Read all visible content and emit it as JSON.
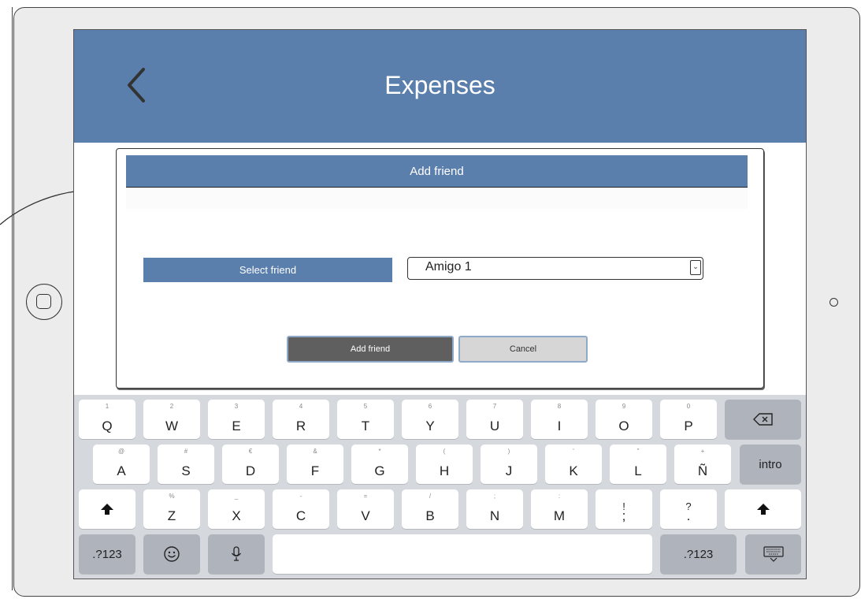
{
  "app": {
    "title": "Expenses"
  },
  "dialog": {
    "title": "Add friend",
    "select_label": "Select friend",
    "selected_friend": "Amigo 1",
    "add_button": "Add friend",
    "cancel_button": "Cancel"
  },
  "keyboard": {
    "row1": [
      {
        "main": "Q",
        "sub": "1"
      },
      {
        "main": "W",
        "sub": "2"
      },
      {
        "main": "E",
        "sub": "3"
      },
      {
        "main": "R",
        "sub": "4"
      },
      {
        "main": "T",
        "sub": "5"
      },
      {
        "main": "Y",
        "sub": "6"
      },
      {
        "main": "U",
        "sub": "7"
      },
      {
        "main": "I",
        "sub": "8"
      },
      {
        "main": "O",
        "sub": "9"
      },
      {
        "main": "P",
        "sub": "0"
      }
    ],
    "row2": [
      {
        "main": "A",
        "sub": "@"
      },
      {
        "main": "S",
        "sub": "#"
      },
      {
        "main": "D",
        "sub": "€"
      },
      {
        "main": "F",
        "sub": "&"
      },
      {
        "main": "G",
        "sub": "*"
      },
      {
        "main": "H",
        "sub": "("
      },
      {
        "main": "J",
        "sub": ")"
      },
      {
        "main": "K",
        "sub": "'"
      },
      {
        "main": "L",
        "sub": "\""
      },
      {
        "main": "Ñ",
        "sub": "+"
      }
    ],
    "row3": [
      {
        "main": "Z",
        "sub": "%"
      },
      {
        "main": "X",
        "sub": "_"
      },
      {
        "main": "C",
        "sub": "-"
      },
      {
        "main": "V",
        "sub": "="
      },
      {
        "main": "B",
        "sub": "/"
      },
      {
        "main": "N",
        "sub": ";"
      },
      {
        "main": "M",
        "sub": ":"
      },
      {
        "main": ";",
        "sub": "!"
      },
      {
        "main": ".",
        "sub": "?"
      }
    ],
    "intro_label": "intro",
    "numeric_left": ".?123",
    "numeric_right": ".?123",
    "icons": {
      "backspace": "backspace-icon",
      "shift": "shift-icon",
      "emoji": "emoji-icon",
      "mic": "microphone-icon",
      "hide": "keyboard-hide-icon"
    }
  },
  "colors": {
    "accent": "#5b7fac",
    "keyboard_bg": "#d5d8dd",
    "dark_key": "#aeb3bc"
  }
}
